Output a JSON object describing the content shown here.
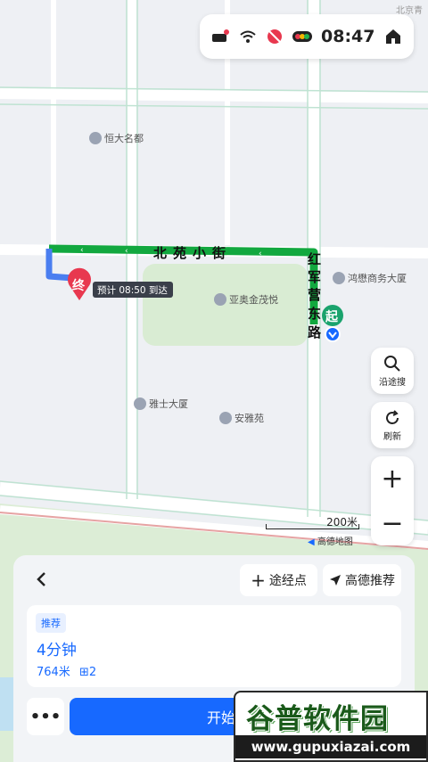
{
  "map": {
    "road_labels": [
      "北",
      "苑",
      "小",
      "街"
    ],
    "road_label_vertical": [
      "红",
      "军",
      "营",
      "东",
      "路"
    ],
    "pois": [
      "恒大名都",
      "亚奥金茂悦",
      "鸿懋商务大厦",
      "雅士大厦",
      "安雅苑"
    ],
    "corner_label": "北京青",
    "end_marker": "终",
    "start_marker": "起",
    "eta_bubble": "预计 08:50 到达",
    "scale_label": "200米",
    "provider_label": "高德地图"
  },
  "status": {
    "time": "08:47"
  },
  "side_buttons": {
    "search_along": "沿途搜",
    "refresh": "刷新",
    "zoom_in": "+",
    "zoom_out": "−"
  },
  "panel": {
    "via_button": "途经点",
    "recommend_button": "高德推荐",
    "route": {
      "tag": "推荐",
      "duration": "4分钟",
      "distance": "764米",
      "lights": "2"
    },
    "more_button": "•••",
    "start_button": "开始导航"
  },
  "watermark": {
    "title": "谷普软件园",
    "url": "www.gupuxiazai.com"
  },
  "colors": {
    "route": "#12a83f",
    "accent": "#1769ff",
    "end": "#e8384f",
    "start": "#1aa36d"
  }
}
